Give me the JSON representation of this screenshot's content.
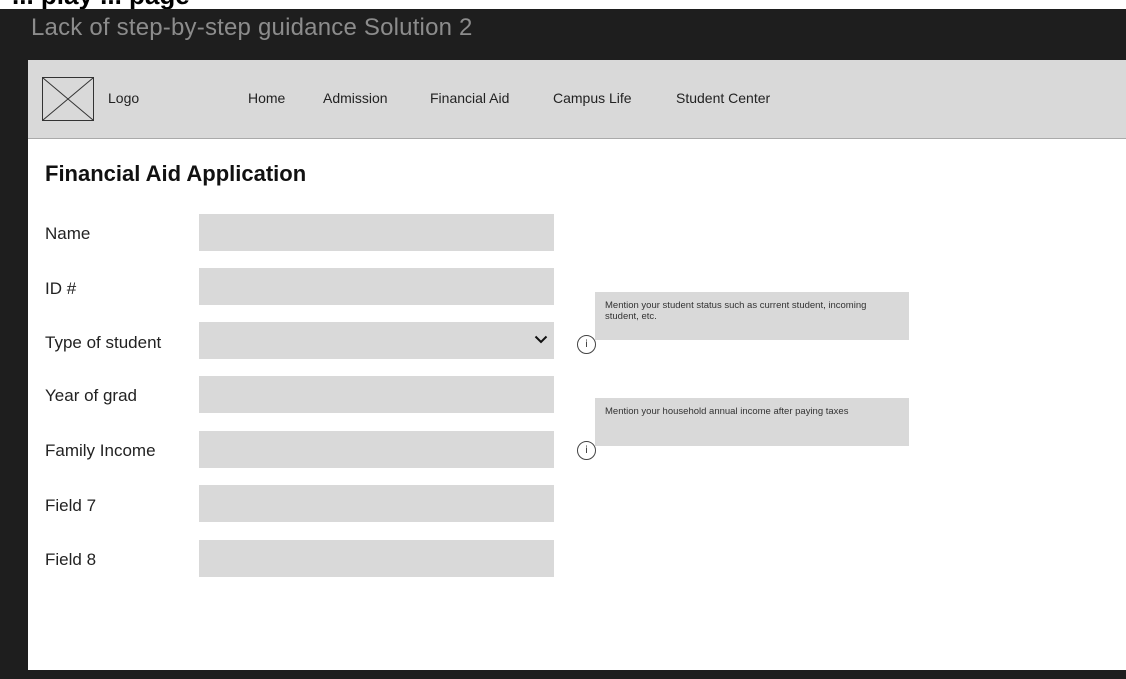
{
  "page_heading_partial": "... play ... page",
  "frame": {
    "title": "Lack of step-by-step guidance Solution 2"
  },
  "navbar": {
    "logo_label": "Logo",
    "items": [
      "Home",
      "Admission",
      "Financial Aid",
      "Campus Life",
      "Student Center"
    ]
  },
  "form": {
    "title": "Financial Aid Application",
    "fields": [
      {
        "label": "Name",
        "value": ""
      },
      {
        "label": "ID #",
        "value": ""
      },
      {
        "label": "Type of student",
        "value": "",
        "type": "dropdown"
      },
      {
        "label": "Year of grad",
        "value": ""
      },
      {
        "label": "Family Income",
        "value": ""
      },
      {
        "label": "Field 7",
        "value": ""
      },
      {
        "label": "Field 8",
        "value": ""
      }
    ]
  },
  "info": {
    "icon_glyph": "i",
    "tooltips": [
      "Mention your student status such as current student, incoming student, etc.",
      "Mention your household annual income after paying taxes"
    ]
  },
  "colors": {
    "frame_background": "#1e1e1e",
    "frame_title": "#8c8c8c",
    "navbar_background": "#d9d9d9",
    "input_background": "#d9d9d9",
    "tooltip_background": "#d9d9d9"
  }
}
